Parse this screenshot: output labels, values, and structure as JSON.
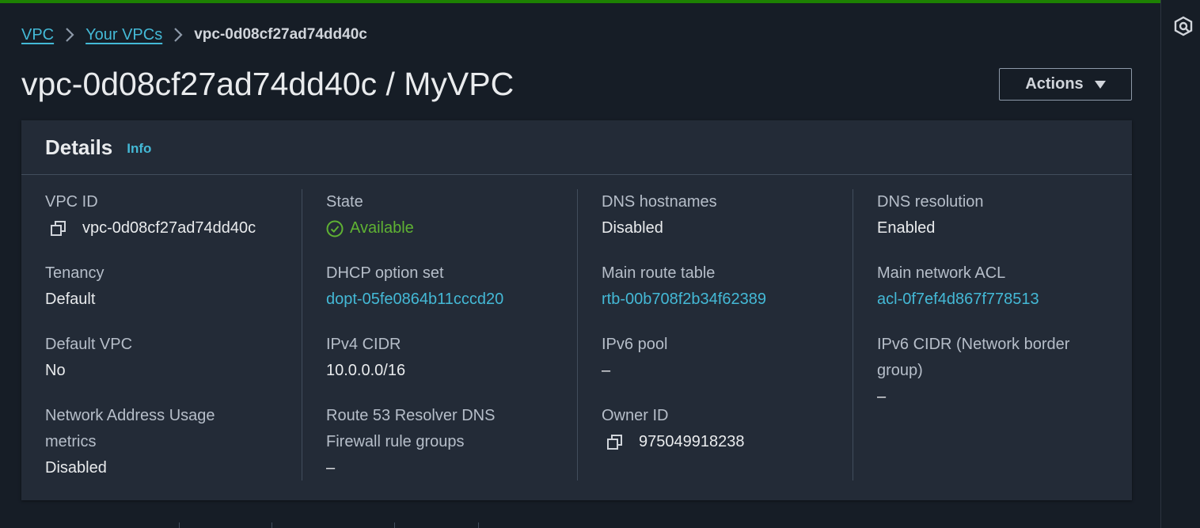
{
  "breadcrumb": {
    "items": [
      "VPC",
      "Your VPCs"
    ],
    "current": "vpc-0d08cf27ad74dd40c"
  },
  "page": {
    "title": "vpc-0d08cf27ad74dd40c / MyVPC",
    "actions_label": "Actions"
  },
  "details": {
    "title": "Details",
    "info_label": "Info",
    "columns": [
      [
        {
          "label": "VPC ID",
          "value": "vpc-0d08cf27ad74dd40c"
        },
        {
          "label": "Tenancy",
          "value": "Default"
        },
        {
          "label": "Default VPC",
          "value": "No"
        },
        {
          "label_line1": "Network Address Usage",
          "label_line2": "metrics",
          "value": "Disabled"
        }
      ],
      [
        {
          "label": "State",
          "value": "Available"
        },
        {
          "label": "DHCP option set",
          "value": "dopt-05fe0864b11cccd20"
        },
        {
          "label": "IPv4 CIDR",
          "value": "10.0.0.0/16"
        },
        {
          "label_line1": "Route 53 Resolver DNS",
          "label_line2": "Firewall rule groups",
          "value": "–"
        }
      ],
      [
        {
          "label": "DNS hostnames",
          "value": "Disabled"
        },
        {
          "label": "Main route table",
          "value": "rtb-00b708f2b34f62389"
        },
        {
          "label": "IPv6 pool",
          "value": "–"
        },
        {
          "label": "Owner ID",
          "value": "975049918238"
        }
      ],
      [
        {
          "label": "DNS resolution",
          "value": "Enabled"
        },
        {
          "label": "Main network ACL",
          "value": "acl-0f7ef4d867f778513"
        },
        {
          "label_line1": "IPv6 CIDR (Network border",
          "label_line2": "group)",
          "value": "–"
        }
      ]
    ]
  },
  "icons": {
    "copy": "copy-icon",
    "status": "check-circle-icon",
    "rail": "settings-hex-icon"
  },
  "colors": {
    "link": "#44b9d6",
    "success": "#5fb233",
    "top_bar": "#1d8102"
  }
}
